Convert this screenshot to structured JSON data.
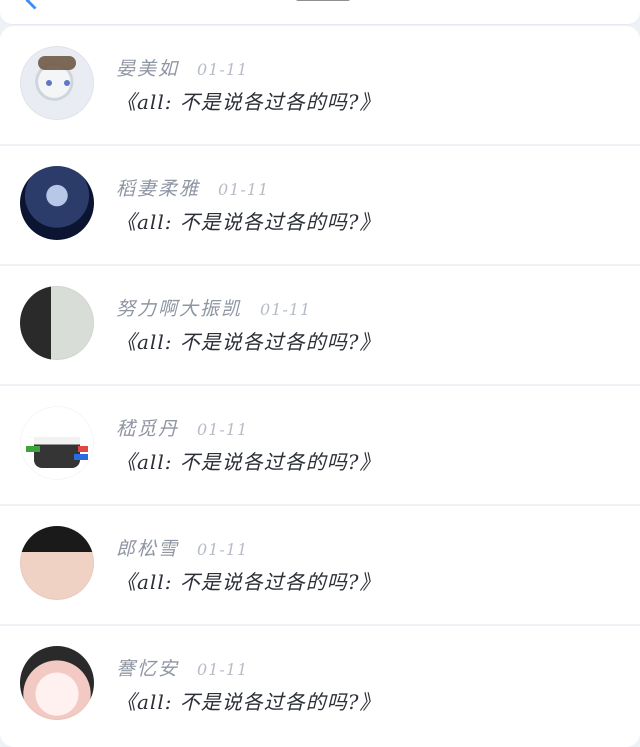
{
  "notifications": [
    {
      "name": "晏美如",
      "time": "01-11",
      "message": "《all: 不是说各过各的吗?》",
      "avatar_icon": "anime-girl-avatar"
    },
    {
      "name": "稻妻柔雅",
      "time": "01-11",
      "message": "《all: 不是说各过各的吗?》",
      "avatar_icon": "night-portrait-avatar"
    },
    {
      "name": "努力啊大振凯",
      "time": "01-11",
      "message": "《all: 不是说各过各的吗?》",
      "avatar_icon": "photo-avatar"
    },
    {
      "name": "嵇觅丹",
      "time": "01-11",
      "message": "《all: 不是说各过各的吗?》",
      "avatar_icon": "sketch-avatar"
    },
    {
      "name": "郎松雪",
      "time": "01-11",
      "message": "《all: 不是说各过各的吗?》",
      "avatar_icon": "face-closeup-avatar"
    },
    {
      "name": "謇忆安",
      "time": "01-11",
      "message": "《all: 不是说各过各的吗?》",
      "avatar_icon": "portrait-avatar"
    }
  ],
  "colors": {
    "accent": "#3a8ef6",
    "background": "#eef1f6",
    "card": "#ffffff",
    "name": "#8f96a3",
    "time": "#b7bcc6",
    "message": "#2b2f36"
  }
}
